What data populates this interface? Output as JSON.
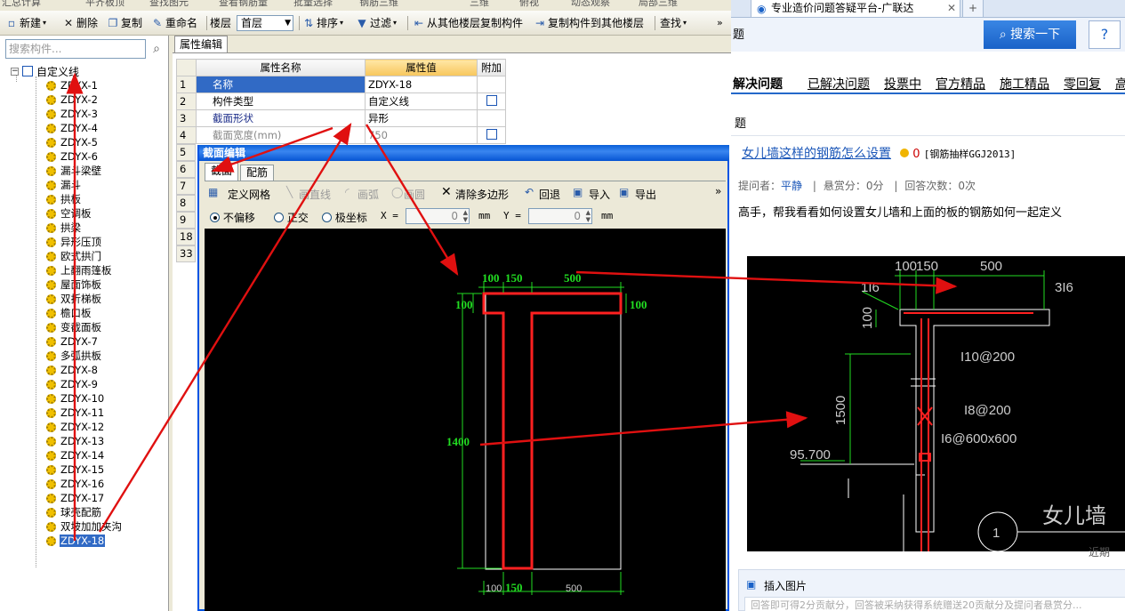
{
  "app": {
    "menu_strip": [
      "汇总计算",
      "平齐板顶",
      "查找图元",
      "查看钢筋量",
      "批量选择",
      "钢筋三维",
      "三维",
      "俯视",
      "动态观察",
      "局部三维"
    ],
    "toolbar": {
      "new": "新建",
      "delete": "删除",
      "copy": "复制",
      "rename": "重命名",
      "floor_label": "楼层",
      "floor_value": "首层",
      "sort": "排序",
      "filter": "过滤",
      "copy_from_floor": "从其他楼层复制构件",
      "copy_to_floor": "复制构件到其他楼层",
      "find": "查找"
    },
    "tree": {
      "search_placeholder": "搜索构件...",
      "root": "自定义线",
      "items": [
        "ZDYX-1",
        "ZDYX-2",
        "ZDYX-3",
        "ZDYX-4",
        "ZDYX-5",
        "ZDYX-6",
        "漏斗梁壁",
        "漏斗",
        "拱板",
        "空调板",
        "拱梁",
        "异形压顶",
        "欧式拱门",
        "上翻雨篷板",
        "屋面饰板",
        "双折梯板",
        "檐口板",
        "变截面板",
        "ZDYX-7",
        "多弧拱板",
        "ZDYX-8",
        "ZDYX-9",
        "ZDYX-10",
        "ZDYX-11",
        "ZDYX-12",
        "ZDYX-13",
        "ZDYX-14",
        "ZDYX-15",
        "ZDYX-16",
        "ZDYX-17",
        "球壳配筋",
        "双坡加加夹沟",
        "ZDYX-18"
      ],
      "selected": "ZDYX-18"
    },
    "property_editor": {
      "tab": "属性编辑",
      "headers": [
        "属性名称",
        "属性值",
        "附加"
      ],
      "rows": [
        {
          "num": "1",
          "name": "名称",
          "value": "ZDYX-18"
        },
        {
          "num": "2",
          "name": "构件类型",
          "value": "自定义线"
        },
        {
          "num": "3",
          "name": "截面形状",
          "value": "异形"
        },
        {
          "num": "4",
          "name": "截面宽度(mm)",
          "value": "750"
        }
      ],
      "more_rows": [
        "5",
        "6",
        "7",
        "8",
        "9",
        "18",
        "33"
      ]
    },
    "section_dialog": {
      "title": "截面编辑",
      "tabs": [
        "截面",
        "配筋"
      ],
      "toolbar": {
        "define_grid": "定义网格",
        "line": "画直线",
        "arc": "画弧",
        "circle": "画圆",
        "clear": "清除多边形",
        "undo": "回退",
        "import": "导入",
        "export": "导出"
      },
      "options": {
        "no_offset": "不偏移",
        "ortho": "正交",
        "polar": "极坐标",
        "x_label": "X =",
        "x_value": "0",
        "y_label": "Y =",
        "y_value": "0",
        "unit": "mm"
      },
      "dims": {
        "top_a": "100",
        "top_b": "150",
        "top_c": "500",
        "left_top": "100",
        "right_top": "100",
        "left_height": "1400",
        "bottom_a": "100",
        "bottom_b": "150",
        "bottom_c": "500"
      }
    }
  },
  "browser": {
    "tab_title": "专业造价问题答疑平台-广联达",
    "search_button": "搜索一下",
    "help": "?",
    "edge_char_1": "题",
    "edge_char_2": "题",
    "nav": [
      "解决问题",
      "已解决问题",
      "投票中",
      "官方精品",
      "施工精品",
      "零回复",
      "高"
    ],
    "question": {
      "title": "女儿墙这样的钢筋怎么设置",
      "coin": "0",
      "tag": "[钢筋抽样GGJ2013]",
      "asker_label": "提问者：",
      "asker": "平静",
      "bounty": "悬赏分：0分",
      "answers": "回答次数：0次",
      "body": "高手，帮我看看如何设置女儿墙和上面的板的钢筋如何一起定义"
    },
    "drawing": {
      "d1": "100",
      "d2": "150",
      "d3": "500",
      "t1": "1I6",
      "t2": "3I6",
      "h1": "100",
      "s1": "I10@200",
      "h2": "1500",
      "s2": "I8@200",
      "s3": "I6@600x600",
      "elev": "95.700",
      "circle_num": "1",
      "caption": "女儿墙"
    },
    "insert_image": "插入图片",
    "hint": "回答即可得2分贡献分，回答被采纳获得系统赠送20贡献分及提问者悬赏分...",
    "side_text": "近期"
  },
  "colors": {
    "arrow": "#e01010",
    "dim_green": "#22dd22",
    "section_red": "#ff2020"
  }
}
